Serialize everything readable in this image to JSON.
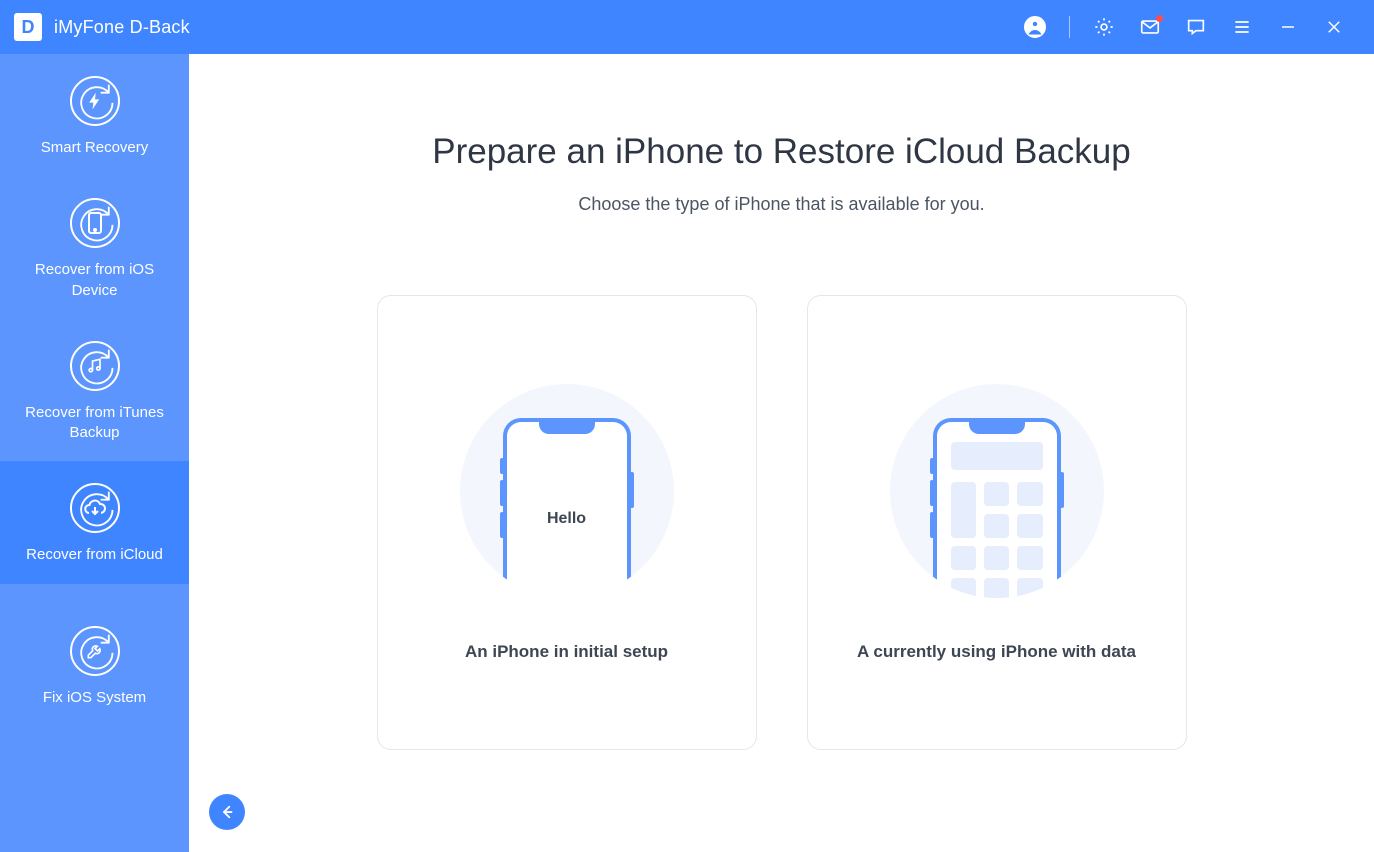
{
  "app": {
    "title": "iMyFone D-Back",
    "logo_letter": "D"
  },
  "sidebar": {
    "items": [
      {
        "label": "Smart Recovery"
      },
      {
        "label": "Recover from iOS Device"
      },
      {
        "label": "Recover from iTunes Backup"
      },
      {
        "label": "Recover from iCloud"
      },
      {
        "label": "Fix iOS System"
      }
    ],
    "active_index": 3
  },
  "main": {
    "title": "Prepare an iPhone to Restore iCloud Backup",
    "subtitle": "Choose the type of iPhone that is available for you.",
    "cards": [
      {
        "caption": "An iPhone in initial setup",
        "phone_text": "Hello"
      },
      {
        "caption": "A currently using iPhone with data"
      }
    ]
  },
  "titlebar_icons": [
    "account",
    "settings",
    "mail",
    "feedback",
    "menu",
    "minimize",
    "close"
  ]
}
